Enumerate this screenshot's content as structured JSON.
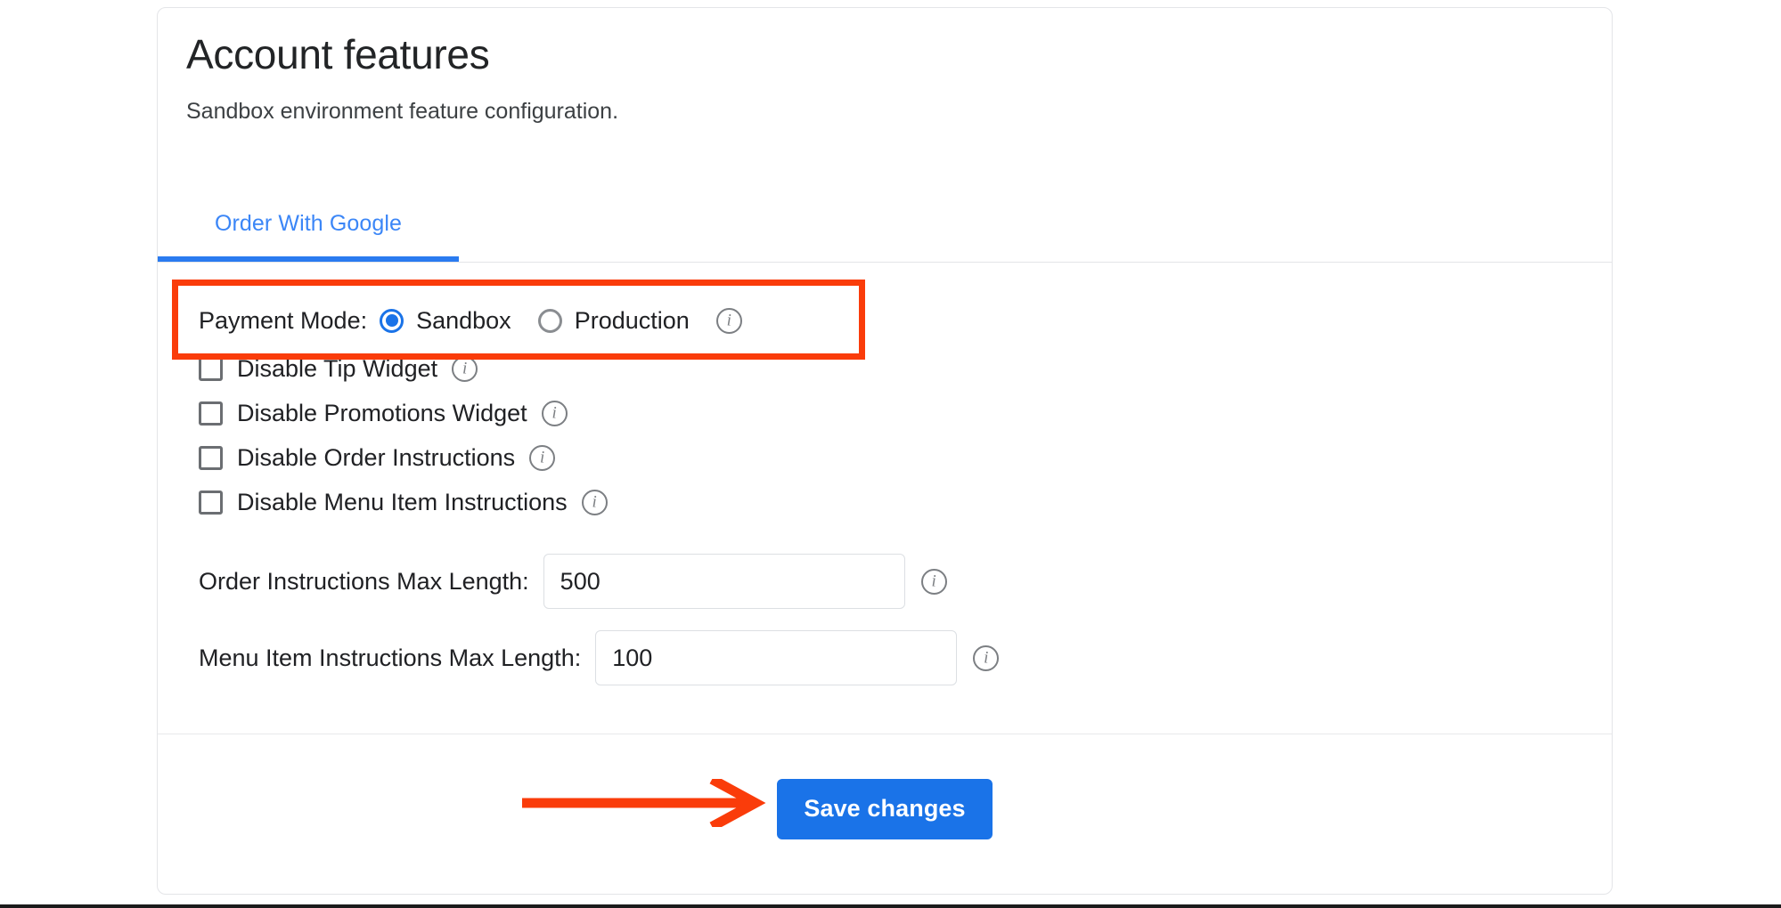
{
  "header": {
    "title": "Account features",
    "subtitle": "Sandbox environment feature configuration."
  },
  "tabs": [
    {
      "label": "Order With Google",
      "active": true
    }
  ],
  "payment_mode": {
    "label": "Payment Mode:",
    "options": [
      {
        "label": "Sandbox",
        "selected": true
      },
      {
        "label": "Production",
        "selected": false
      }
    ],
    "info_glyph": "i"
  },
  "checkboxes": [
    {
      "label": "Disable Tip Widget",
      "checked": false
    },
    {
      "label": "Disable Promotions Widget",
      "checked": false
    },
    {
      "label": "Disable Order Instructions",
      "checked": false
    },
    {
      "label": "Disable Menu Item Instructions",
      "checked": false
    }
  ],
  "fields": [
    {
      "label": "Order Instructions Max Length:",
      "value": "500"
    },
    {
      "label": "Menu Item Instructions Max Length:",
      "value": "100"
    }
  ],
  "footer": {
    "save_label": "Save changes"
  },
  "colors": {
    "accent_blue": "#1a73e8",
    "tab_blue": "#3b86f7",
    "annotation_red": "#fa3c0a",
    "border_gray": "#e4e5e8",
    "text_dark": "#202124"
  },
  "annotations": {
    "highlight_box_target": "payment-mode-row",
    "arrow_target": "save-changes-button"
  }
}
